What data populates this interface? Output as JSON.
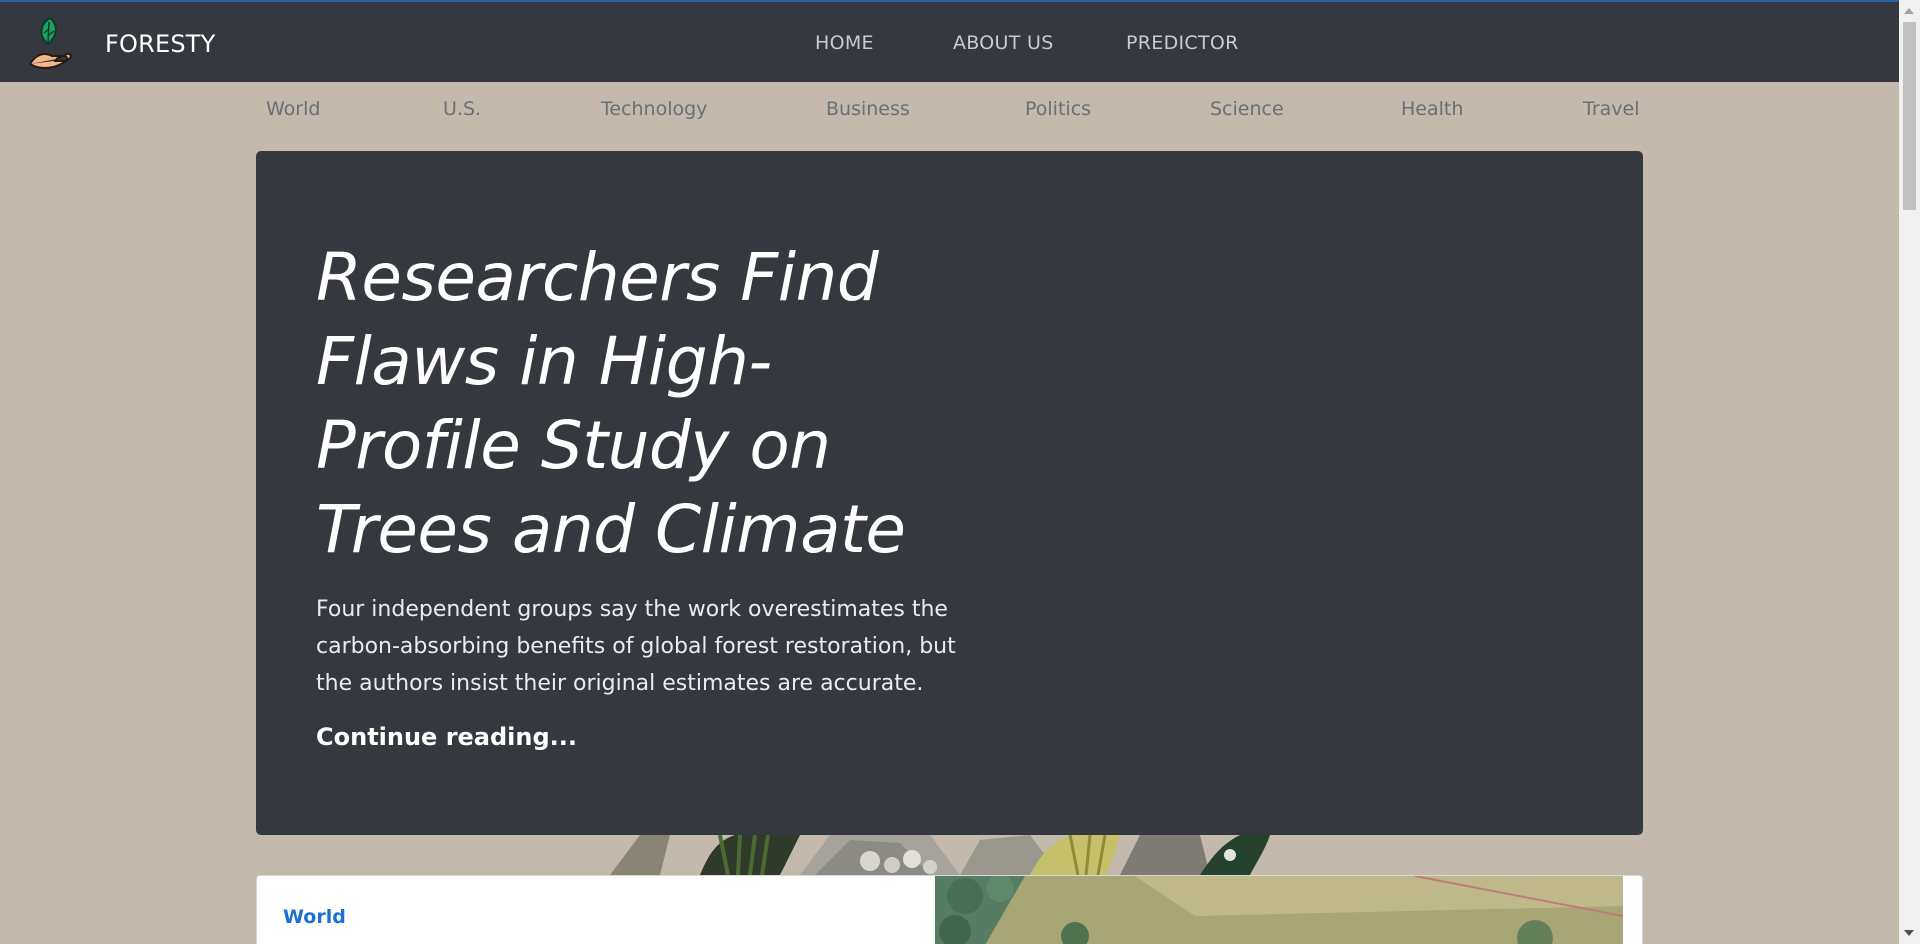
{
  "header": {
    "brand_name": "FORESTY",
    "logo_icon": "hand-holding-leaf-icon",
    "nav": [
      {
        "label": "HOME"
      },
      {
        "label": "ABOUT US"
      },
      {
        "label": "PREDICTOR"
      }
    ]
  },
  "categories": [
    {
      "label": "World"
    },
    {
      "label": "U.S."
    },
    {
      "label": "Technology"
    },
    {
      "label": "Business"
    },
    {
      "label": "Politics"
    },
    {
      "label": "Science"
    },
    {
      "label": "Health"
    },
    {
      "label": "Travel"
    }
  ],
  "hero": {
    "title": "Researchers Find Flaws in High-Profile Study on Trees and Climate",
    "lead": "Four independent groups say the work overestimates the carbon-absorbing benefits of global forest restoration, but the authors insist their original estimates are accurate.",
    "link_label": "Continue reading..."
  },
  "featured_card": {
    "category": "World",
    "image_icon": "forest-aerial-photo"
  },
  "colors": {
    "page_background": "#c3b9ad",
    "header_background": "#35393f",
    "hero_background": "#35393f",
    "accent_link": "#1d6fd8"
  }
}
